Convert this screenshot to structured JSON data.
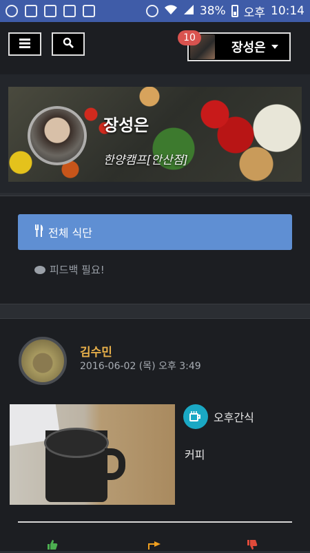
{
  "status_bar": {
    "battery": "38%",
    "ampm": "오후",
    "time": "10:14"
  },
  "header": {
    "menu_icon": "hamburger-icon",
    "search_icon": "search-icon",
    "notification_count": "10",
    "user_name": "장성은"
  },
  "profile": {
    "name": "장성은",
    "camp": "한양캠프[안산점]"
  },
  "menu": {
    "all_meals": "전체 식단",
    "feedback_needed": "피드백 필요!"
  },
  "post": {
    "author": "김수민",
    "date": "2016-06-02 (목) 오후 3:49",
    "meal_type": "오후간식",
    "meal_text": "커피",
    "reactions": [
      "thumbs-up-icon",
      "point-right-icon",
      "thumbs-down-icon"
    ]
  },
  "colors": {
    "status_bar": "#3f5ca8",
    "primary_button": "#5f8fd3",
    "author": "#e8b04a",
    "badge": "#d9534f",
    "meal_icon": "#1aa8c4"
  }
}
